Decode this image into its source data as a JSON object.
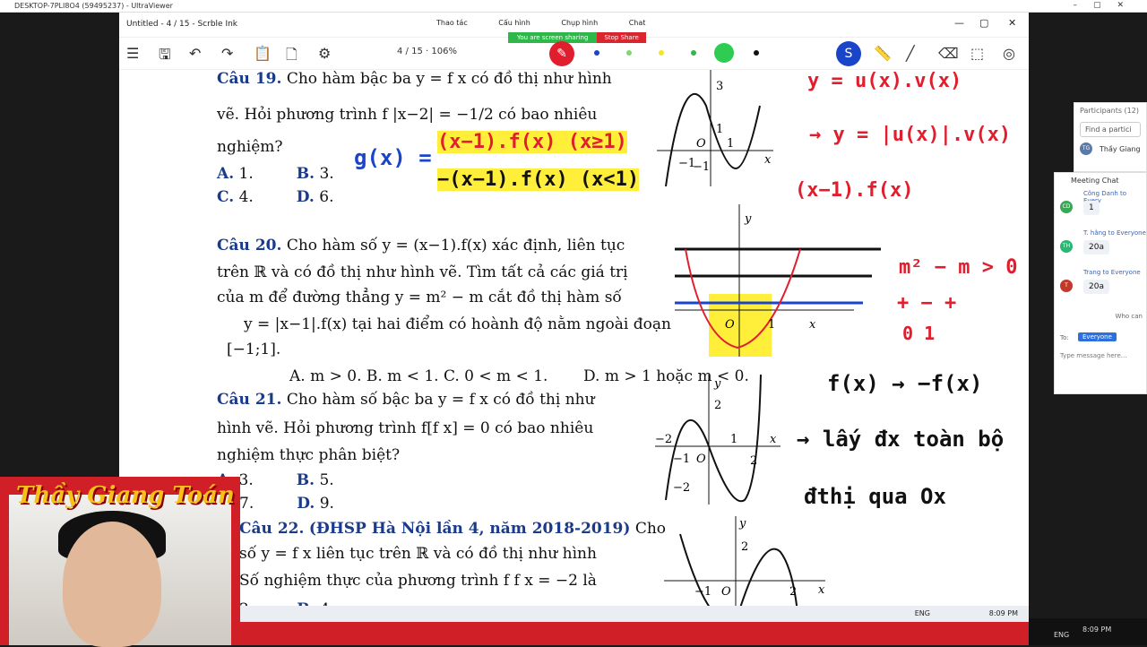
{
  "viewer": {
    "title": "DESKTOP-7PLI8O4 (59495237) - UltraViewer"
  },
  "app": {
    "title": "Untitled - 4 / 15 - Scrble Ink",
    "page": "4 / 15",
    "zoom": "106%"
  },
  "share_toolbar": {
    "items": [
      "Thao tác",
      "Cấu hình",
      "Chụp hình",
      "Chat"
    ],
    "sharing": "You are screen sharing",
    "stop": "Stop Share"
  },
  "document": {
    "q19": {
      "header": "Câu 19.",
      "line1": "Cho hàm bậc ba  y = f  x   có đồ thị như hình",
      "line2": "vẽ. Hỏi phương trình  f |x−2| = −1/2  có bao nhiêu",
      "line3": "nghiệm?",
      "a": "A.",
      "a_val": "1.",
      "b": "B.",
      "b_val": "3.",
      "c": "C.",
      "c_val": "4.",
      "d": "D.",
      "d_val": "6."
    },
    "q20": {
      "header": "Câu 20.",
      "line1": "Cho hàm số  y = (x−1).f(x)  xác định, liên tục",
      "line2": "trên ℝ và có đồ thị như hình vẽ. Tìm tất cả các giá trị",
      "line3": "của  m  để đường thẳng  y = m² − m  cắt đồ thị hàm số",
      "line4": "y = |x−1|.f(x)  tại hai điểm có hoành độ nằm ngoài đoạn",
      "line5": "[−1;1].",
      "options": "A.  m > 0.   B.  m < 1.   C.  0 < m < 1.",
      "d": "D.  m > 1  hoặc  m < 0."
    },
    "q21": {
      "header": "Câu 21.",
      "line1": "Cho hàm số bậc ba  y = f  x   có đồ thị như",
      "line2": "hình vẽ. Hỏi phương trình  f[f  x] = 0  có bao nhiêu",
      "line3": "nghiệm thực phân biệt?",
      "a": "A.",
      "a_val": "3.",
      "b": "B.",
      "b_val": "5.",
      "c_val": "7.",
      "d": "D.",
      "d_val": "9."
    },
    "q22": {
      "header": "Câu 22.",
      "source": "(ĐHSP Hà Nội lần 4, năm 2018-2019)",
      "line1_tail": "Cho",
      "line2": "số  y = f  x   liên tục trên ℝ và có đồ thị như hình",
      "line3": "Số nghiệm thực của phương trình  f  f  x   = −2  là",
      "a_val": "2.",
      "b": "B.",
      "b_val": "4."
    }
  },
  "ink": {
    "g_def": "g(x) =",
    "case1": "(x−1).f(x)  (x≥1)",
    "case2": "−(x−1).f(x)  (x<1)",
    "top_right": "y = u(x).v(x)",
    "abs_rule": "→ y = |u(x)|.v(x)",
    "factor": "(x−1).f(x)",
    "cond": "m² − m > 0",
    "signs": "+  −  +",
    "roots": "0      1",
    "reflect": "f(x) → −f(x)",
    "note1": "→ lấy đx toàn bộ",
    "note2": "đthị qua Ox"
  },
  "graph_labels": {
    "g1": {
      "y3": "3",
      "y1": "1",
      "o": "O",
      "x1": "1",
      "xm1": "−1",
      "ym1": "−1",
      "x": "x"
    },
    "g2": {
      "y": "y",
      "o": "O",
      "one": "1",
      "x": "x"
    },
    "g3": {
      "y": "y",
      "y2": "2",
      "xm2": "−2",
      "xm1": "−1",
      "o": "O",
      "x1": "1",
      "x2": "2",
      "ym2": "−2",
      "x": "x"
    },
    "g4": {
      "y": "y",
      "y2": "2",
      "xm1": "−1",
      "o": "O",
      "x2": "2",
      "x1": "1",
      "xm2": "−2",
      "x": "x"
    }
  },
  "participants": {
    "title": "Participants (12)",
    "search": "Find a partici",
    "first": "Thầy Giang"
  },
  "chat": {
    "title": "Meeting Chat",
    "messages": [
      {
        "from": "Công Danh to Every",
        "initials": "CD",
        "color": "#3aa757",
        "text": "1"
      },
      {
        "from": "T. hằng to Everyone",
        "initials": "TH",
        "color": "#2bb673",
        "text": "20a"
      },
      {
        "from": "Trang to Everyone",
        "initials": "T",
        "color": "#c0392b",
        "text": "20a"
      }
    ],
    "who": "Who can",
    "to_label": "To:",
    "to_value": "Everyone",
    "placeholder": "Type message here..."
  },
  "webcam": {
    "title": "Thầy Giang Toán"
  },
  "taskbar": {
    "lang": "ENG",
    "time": "8:09 PM"
  },
  "tray": {
    "time": "8:09 PM",
    "lang": "ENG"
  },
  "colors": {
    "ink_red": "#e01e2e",
    "ink_blue": "#1a45c8",
    "highlight": "#ffef3a",
    "brand_red": "#d01f26"
  }
}
